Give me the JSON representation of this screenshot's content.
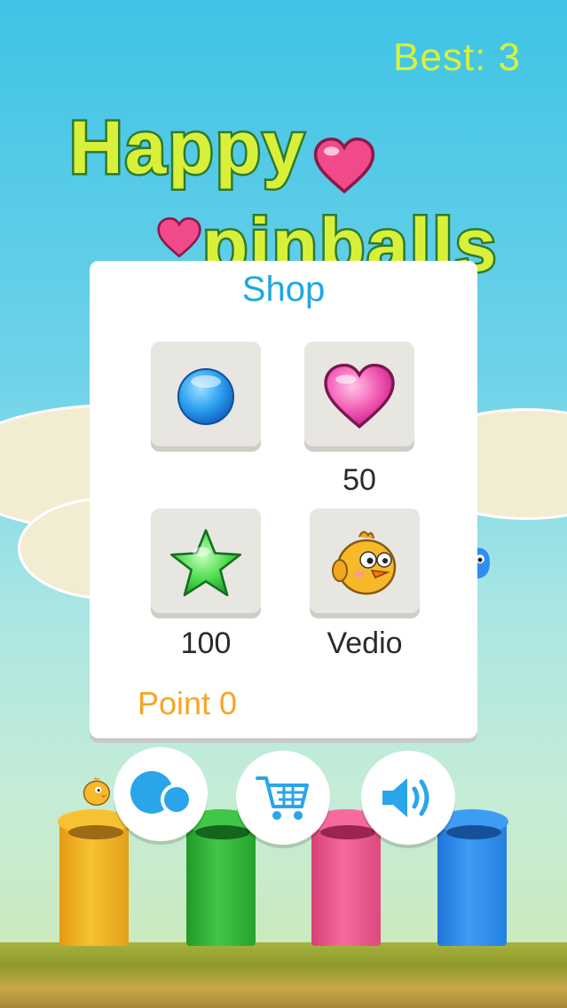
{
  "header": {
    "best_label": "Best: 3"
  },
  "logo": {
    "line1": "Happy",
    "line2": "pinballs"
  },
  "shop": {
    "title": "Shop",
    "items": [
      {
        "icon": "blue-ball-icon",
        "price": ""
      },
      {
        "icon": "pink-heart-icon",
        "price": "50"
      },
      {
        "icon": "green-star-icon",
        "price": "100"
      },
      {
        "icon": "yellow-chick-icon",
        "price": "Vedio"
      }
    ],
    "point_label": "Point 0"
  },
  "bottom_buttons": [
    {
      "icon": "balls-icon"
    },
    {
      "icon": "shopping-cart-icon"
    },
    {
      "icon": "sound-icon"
    }
  ],
  "pipes": [
    {
      "color": "#f2b31f"
    },
    {
      "color": "#34b83a"
    },
    {
      "color": "#f0588f"
    },
    {
      "color": "#2f8ff0"
    }
  ],
  "colors": {
    "accent_blue": "#1fa8e0",
    "point_orange": "#f6a623",
    "best_yellow": "#d8f23a"
  }
}
